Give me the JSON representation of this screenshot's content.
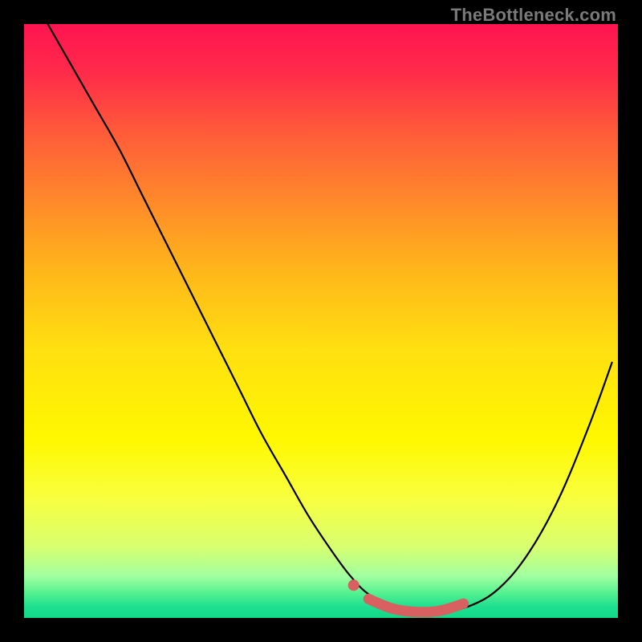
{
  "watermark": "TheBottleneck.com",
  "chart_data": {
    "type": "line",
    "title": "",
    "xlabel": "",
    "ylabel": "",
    "xlim": [
      0,
      100
    ],
    "ylim": [
      0,
      100
    ],
    "grid": false,
    "legend": false,
    "series": [
      {
        "name": "curve",
        "x": [
          4,
          8,
          12,
          16,
          20,
          24,
          28,
          32,
          36,
          40,
          44,
          48,
          52,
          55,
          58,
          62,
          66,
          70,
          75,
          80,
          85,
          90,
          95,
          99
        ],
        "y": [
          100,
          93,
          86,
          79,
          71,
          63,
          55,
          47,
          39,
          31,
          24,
          17,
          11,
          7,
          4,
          2,
          1,
          1,
          2,
          5,
          11,
          20,
          32,
          43
        ]
      }
    ],
    "annotations": [
      {
        "name": "highlight-segment",
        "type": "line",
        "x": [
          58,
          62,
          66,
          70,
          74
        ],
        "y": [
          3.2,
          1.6,
          1.0,
          1.2,
          2.4
        ]
      },
      {
        "name": "highlight-dot",
        "type": "point",
        "x": 55.5,
        "y": 5.5
      }
    ],
    "background_gradient": {
      "top": "#ff1450",
      "mid": "#fff800",
      "bottom": "#10d888"
    }
  }
}
